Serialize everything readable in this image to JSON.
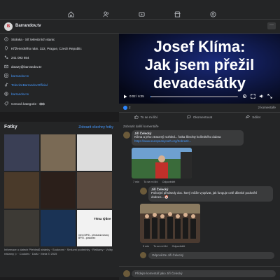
{
  "page": {
    "name": "Barrandov.tv",
    "avatar_letter": "B"
  },
  "intro": [
    {
      "icon": "info-icon",
      "text": "Stránka · Síť televizních stanic",
      "link": false
    },
    {
      "icon": "location-icon",
      "text": "Kříženeckého nám. 322, Prague, Czech Republic",
      "link": false
    },
    {
      "icon": "phone-icon",
      "text": "241 093 654",
      "link": false
    },
    {
      "icon": "email-icon",
      "text": "dotazy@barrandov.tv",
      "link": false
    },
    {
      "icon": "instagram-icon",
      "text": "barrandov.tv",
      "link": true
    },
    {
      "icon": "tiktok-icon",
      "text": "TelevizeBarrandovOfficial",
      "link": true
    },
    {
      "icon": "globe-icon",
      "text": "barrandov.tv",
      "link": true
    },
    {
      "icon": "price-icon",
      "text": "Cenová kategorie · $$$",
      "link": false
    }
  ],
  "photos": {
    "title": "Fotky",
    "see_all": "Zobrazit všechny fotky",
    "items": [
      {
        "label": "",
        "bg": "#3a3f55"
      },
      {
        "label": "",
        "bg": "#7a6a55"
      },
      {
        "label": "",
        "bg": "#dcdcdc"
      },
      {
        "label": "",
        "bg": "#4a3a2a"
      },
      {
        "label": "",
        "bg": "#2b1f1a"
      },
      {
        "label": "",
        "bg": "#5a4a3f"
      },
      {
        "label": "",
        "bg": "#3d3a35"
      },
      {
        "label": "",
        "bg": "#1a3355"
      },
      {
        "label": "Téma týdne",
        "bg": "#f2f2f2"
      }
    ],
    "overlay_caption": "mění BPSI - předseda strany BPSI - poslanec"
  },
  "footer": "Informace o datech Přehledů stránky · Soukromí · Smluvní podmínky · Reklamy · Volby reklamy ▷ · Cookies · Další · Meta © 2025",
  "video": {
    "title_line1": "Josef Klíma:",
    "title_line2": "Jak jsem přežil",
    "title_line3": "devadesátky",
    "time": "0:02 / 6:25",
    "progress": 0.01
  },
  "stats": {
    "reactions": "2",
    "comments": "2 komentáře"
  },
  "actions": [
    {
      "icon": "like-icon",
      "label": "To se mi líbí"
    },
    {
      "icon": "comment-icon",
      "label": "Okomentovat"
    },
    {
      "icon": "share-icon",
      "label": "Sdílet"
    }
  ],
  "comments": {
    "sort_label": "Zobrazit další komentáře",
    "items": [
      {
        "author": "Jiří Čelecký",
        "text_line1": "Klíma a jeho ztracený rozhled... fotka Šlechty kolínského dubna",
        "link": "https://www.europeanyouth.org/Zobrazit...",
        "meta_time": "7 min",
        "meta_like": "To se mi líbí",
        "meta_reply": "Odpovědět"
      },
      {
        "author": "Jiří Čelecký",
        "text_line1": "Policejní předsedy doc. který může vyzpívat, jak funguje celé dlinské podsvětí",
        "text_line2": "dodnes... 🤡",
        "meta_time": "5 min",
        "meta_like": "To se mi líbí",
        "meta_reply": "Odpovědět"
      }
    ],
    "reply_placeholder": "Odpovězte Jiří Čelecký",
    "main_placeholder": "Přidejte komentář jako Jiří Čelecký"
  },
  "colors": {
    "accent": "#4599ff",
    "bg": "#1c1c1d",
    "card": "#242526",
    "bubble": "#3a3b3c"
  }
}
